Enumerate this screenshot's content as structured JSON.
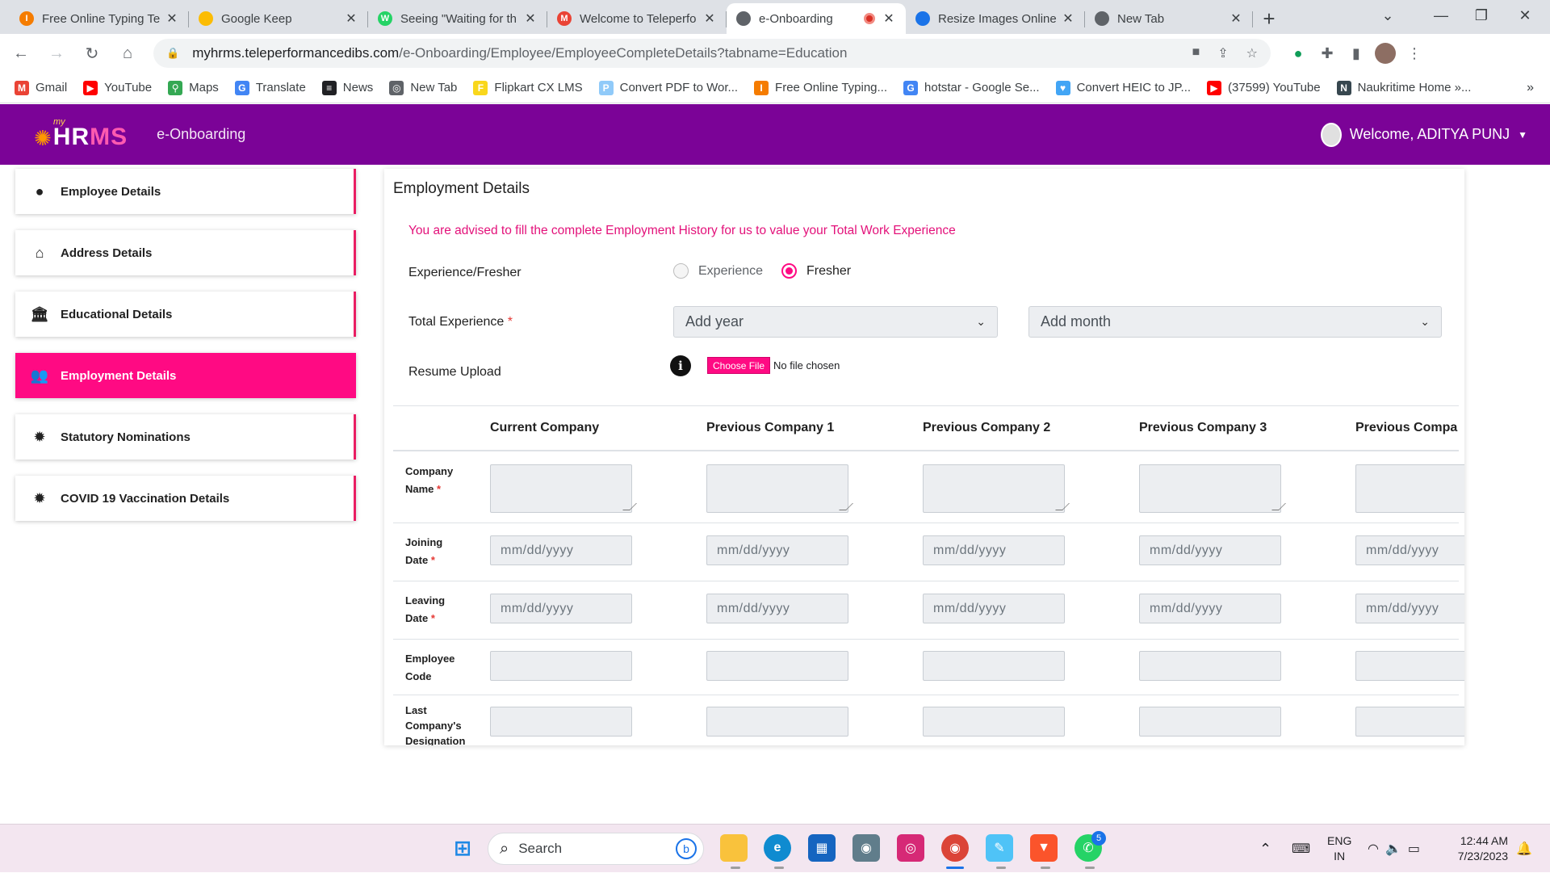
{
  "browser": {
    "tabs": [
      {
        "title": "Free Online Typing Te",
        "icon_color": "#f57c00",
        "icon_char": "I",
        "active": false
      },
      {
        "title": "Google Keep",
        "icon_color": "#fbbc04",
        "icon_char": "",
        "active": false
      },
      {
        "title": "Seeing \"Waiting for th",
        "icon_color": "#25d366",
        "icon_char": "W",
        "active": false
      },
      {
        "title": "Welcome to Teleperfo",
        "icon_color": "#ea4335",
        "icon_char": "M",
        "active": false
      },
      {
        "title": "e-Onboarding",
        "icon_color": "#5f6368",
        "icon_char": "",
        "active": true
      },
      {
        "title": "Resize Images Online",
        "icon_color": "#1a73e8",
        "icon_char": "",
        "active": false
      },
      {
        "title": "New Tab",
        "icon_color": "#5f6368",
        "icon_char": "",
        "active": false
      }
    ],
    "url_host": "myhrms.teleperformancedibs.com",
    "url_path": "/e-Onboarding/Employee/EmployeeCompleteDetails?tabname=Education",
    "bookmarks": [
      {
        "label": "Gmail",
        "color": "#ea4335",
        "char": "M"
      },
      {
        "label": "YouTube",
        "color": "#ff0000",
        "char": "▶"
      },
      {
        "label": "Maps",
        "color": "#34a853",
        "char": "⚲"
      },
      {
        "label": "Translate",
        "color": "#4285f4",
        "char": "G"
      },
      {
        "label": "News",
        "color": "#202124",
        "char": "≡"
      },
      {
        "label": "New Tab",
        "color": "#5f6368",
        "char": "◎"
      },
      {
        "label": "Flipkart CX LMS",
        "color": "#f9d71c",
        "char": "F"
      },
      {
        "label": "Convert PDF to Wor...",
        "color": "#90caf9",
        "char": "P"
      },
      {
        "label": "Free Online Typing...",
        "color": "#f57c00",
        "char": "I"
      },
      {
        "label": "hotstar - Google Se...",
        "color": "#4285f4",
        "char": "G"
      },
      {
        "label": "Convert HEIC to JP...",
        "color": "#42a5f5",
        "char": "♥"
      },
      {
        "label": "(37599) YouTube",
        "color": "#ff0000",
        "char": "▶"
      },
      {
        "label": "Naukritime Home »...",
        "color": "#37474f",
        "char": "N"
      }
    ]
  },
  "app": {
    "logo_my": "my",
    "logo_hr": "HR",
    "logo_ms": "MS",
    "app_name": "e-Onboarding",
    "welcome": "Welcome, ADITYA PUNJ"
  },
  "sidebar": {
    "items": [
      {
        "label": "Employee Details",
        "icon": "user-circle-icon",
        "glyph": "●",
        "active": false
      },
      {
        "label": "Address Details",
        "icon": "home-icon",
        "glyph": "⌂",
        "active": false
      },
      {
        "label": "Educational Details",
        "icon": "university-icon",
        "glyph": "🏛",
        "active": false
      },
      {
        "label": "Employment Details",
        "icon": "users-icon",
        "glyph": "👥",
        "active": true
      },
      {
        "label": "Statutory Nominations",
        "icon": "certificate-icon",
        "glyph": "✹",
        "active": false
      },
      {
        "label": "COVID 19 Vaccination Details",
        "icon": "certificate-icon",
        "glyph": "✹",
        "active": false
      }
    ]
  },
  "employment": {
    "title": "Employment Details",
    "advice": "You are advised to fill the complete Employment History for us to value your Total Work Experience",
    "exp_label": "Experience/Fresher",
    "opt_experience": "Experience",
    "opt_fresher": "Fresher",
    "selected": "Fresher",
    "total_exp_label": "Total Experience",
    "year_placeholder": "Add year",
    "month_placeholder": "Add month",
    "resume_label": "Resume Upload",
    "choose_file": "Choose File",
    "no_file": "No file chosen",
    "columns": [
      "Current Company",
      "Previous Company 1",
      "Previous Company 2",
      "Previous Company 3",
      "Previous Compa"
    ],
    "rows": [
      {
        "label_lines": [
          "Company",
          "Name"
        ],
        "required": true,
        "type": "textarea"
      },
      {
        "label_lines": [
          "Joining",
          "Date"
        ],
        "required": true,
        "type": "date"
      },
      {
        "label_lines": [
          "Leaving",
          "Date"
        ],
        "required": true,
        "type": "date"
      },
      {
        "label_lines": [
          "Employee",
          "Code"
        ],
        "required": false,
        "type": "text"
      },
      {
        "label_lines": [
          "Last",
          "Company's",
          "Designation"
        ],
        "required": false,
        "type": "text"
      }
    ],
    "date_placeholder": "mm/dd/yyyy",
    "required_mark": "*"
  },
  "taskbar": {
    "search": "Search",
    "lang": "ENG",
    "region": "IN",
    "time": "12:44 AM",
    "date": "7/23/2023",
    "whatsapp_badge": "5"
  }
}
